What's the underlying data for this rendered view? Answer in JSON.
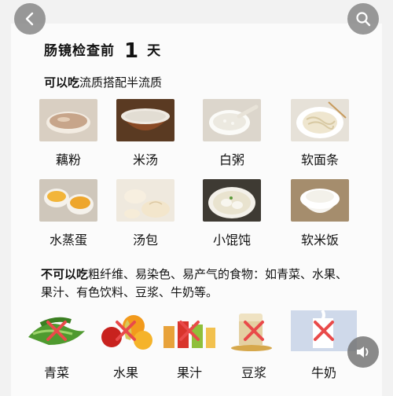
{
  "header": {
    "title_prefix": "肠镜检查前",
    "title_number": "1",
    "title_suffix": "天"
  },
  "allowed": {
    "heading_bold": "可以吃",
    "heading_rest": "流质搭配半流质",
    "items": [
      {
        "label": "藕粉",
        "icon": "lotus-root-starch-bowl"
      },
      {
        "label": "米汤",
        "icon": "rice-soup-bowl"
      },
      {
        "label": "白粥",
        "icon": "white-porridge-bowl"
      },
      {
        "label": "软面条",
        "icon": "soft-noodles-bowl"
      },
      {
        "label": "水蒸蛋",
        "icon": "steamed-egg"
      },
      {
        "label": "汤包",
        "icon": "soup-dumplings"
      },
      {
        "label": "小馄饨",
        "icon": "wonton-bowl"
      },
      {
        "label": "软米饭",
        "icon": "soft-rice-bowl"
      }
    ]
  },
  "forbidden": {
    "heading_bold": "不可以吃",
    "heading_rest": "粗纤维、易染色、易产气的食物：如青菜、水果、果汁、有色饮料、豆浆、牛奶等。",
    "items": [
      {
        "label": "青菜",
        "icon": "green-vegetables"
      },
      {
        "label": "水果",
        "icon": "fruits"
      },
      {
        "label": "果汁",
        "icon": "fruit-juice"
      },
      {
        "label": "豆浆",
        "icon": "soy-milk"
      },
      {
        "label": "牛奶",
        "icon": "milk"
      }
    ]
  },
  "controls": {
    "back_icon": "chevron-left-icon",
    "search_icon": "search-icon",
    "sound_icon": "speaker-icon"
  },
  "colors": {
    "cross": "#e94a4a",
    "button_bg": "#787878"
  }
}
